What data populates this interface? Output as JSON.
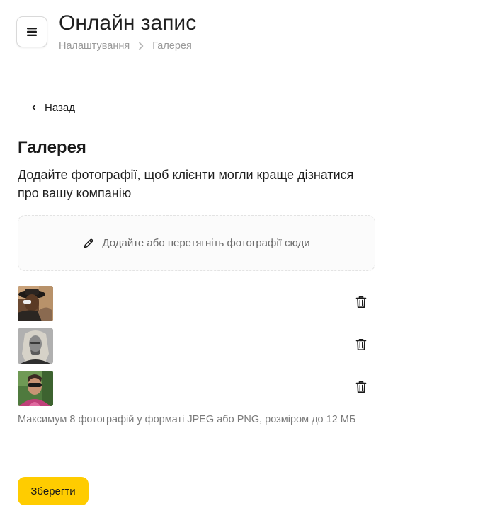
{
  "header": {
    "title": "Онлайн запис",
    "breadcrumb": [
      "Налаштування",
      "Галерея"
    ]
  },
  "back_label": "Назад",
  "section": {
    "title": "Галерея",
    "description": "Додайте фотографії, щоб клієнти могли краще дізнатися про вашу компанію"
  },
  "dropzone": {
    "label": "Додайте або перетягніть фотографії сюди",
    "icon": "pencil-icon"
  },
  "photos": [
    {
      "thumb": "photo-man-with-hat",
      "delete_icon": "trash-icon"
    },
    {
      "thumb": "photo-man-long-hair-grayscale",
      "delete_icon": "trash-icon"
    },
    {
      "thumb": "photo-man-sunglasses",
      "delete_icon": "trash-icon"
    }
  ],
  "hint": "Максимум 8 фотографій у форматі JPEG або PNG, розміром до 12 МБ",
  "save_label": "Зберегти",
  "colors": {
    "accent": "#ffcc00",
    "text": "#1a1a1a",
    "muted": "#9a9a9a",
    "border": "#e6e6e6"
  }
}
